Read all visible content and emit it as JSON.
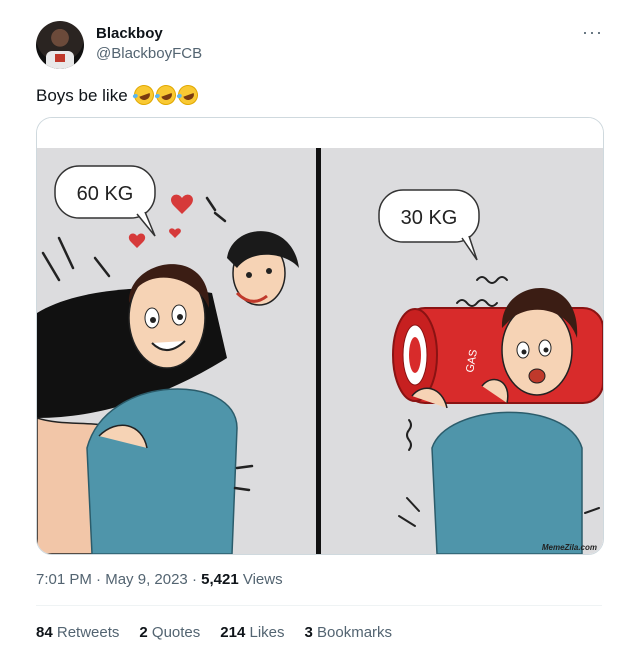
{
  "author": {
    "name": "Blackboy",
    "handle": "@BlackboyFCB"
  },
  "more_icon": "more-horizontal-icon",
  "tweet": {
    "text": "Boys be like",
    "emojis": [
      "rolling-on-floor-laughing",
      "rolling-on-floor-laughing",
      "rolling-on-floor-laughing"
    ]
  },
  "media": {
    "left_panel": {
      "bubble": "60 KG"
    },
    "right_panel": {
      "bubble": "30 KG",
      "cylinder_label": "GAS"
    },
    "watermark": "MemeZila.com"
  },
  "meta": {
    "time": "7:01 PM",
    "sep1": "·",
    "date": "May 9, 2023",
    "sep2": "·",
    "views_count": "5,421",
    "views_label": "Views"
  },
  "stats": [
    {
      "count": "84",
      "label": "Retweets"
    },
    {
      "count": "2",
      "label": "Quotes"
    },
    {
      "count": "214",
      "label": "Likes"
    },
    {
      "count": "3",
      "label": "Bookmarks"
    }
  ]
}
